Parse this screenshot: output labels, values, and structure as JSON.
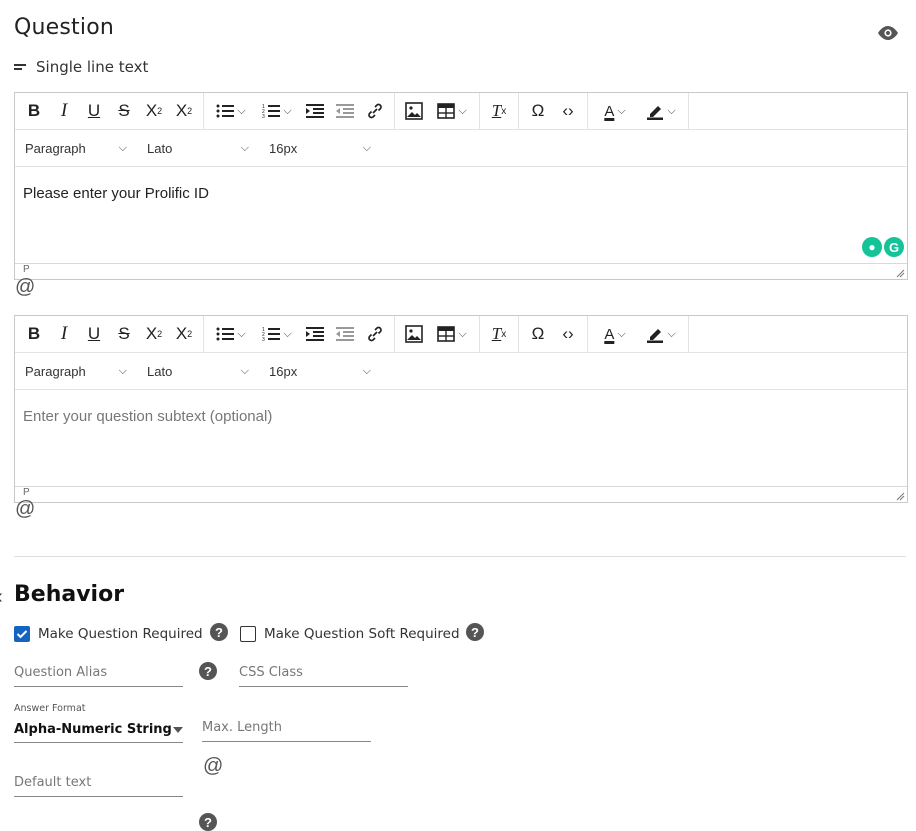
{
  "question": {
    "title": "Question",
    "type_label": "Single line text"
  },
  "editor_toolbar": {
    "paragraph": "Paragraph",
    "font": "Lato",
    "size": "16px",
    "buttons": [
      "bold",
      "italic",
      "underline",
      "strikethrough",
      "superscript",
      "subscript",
      "bullet-list",
      "numbered-list",
      "indent",
      "outdent",
      "link",
      "image",
      "table",
      "clear-format",
      "special-char",
      "source-code",
      "text-color",
      "highlight"
    ]
  },
  "editor1": {
    "content": "Please enter your Prolific ID",
    "status": "P"
  },
  "editor2": {
    "placeholder": "Enter your question subtext (optional)",
    "status": "P"
  },
  "behavior": {
    "title": "Behavior",
    "required_label": "Make Question Required",
    "required_checked": true,
    "soft_required_label": "Make Question Soft Required",
    "soft_required_checked": false,
    "alias_placeholder": "Question Alias",
    "css_placeholder": "CSS Class",
    "answer_format_label": "Answer Format",
    "answer_format_value": "Alpha-Numeric String",
    "max_length_placeholder": "Max. Length",
    "default_text_placeholder": "Default text"
  },
  "icons": {
    "preview": "eye-icon",
    "mention": "at-icon",
    "help": "help-circle-icon",
    "grammarly": "grammarly-icon"
  },
  "colors": {
    "accent": "#1565c0",
    "grammarly": "#15c39a"
  }
}
